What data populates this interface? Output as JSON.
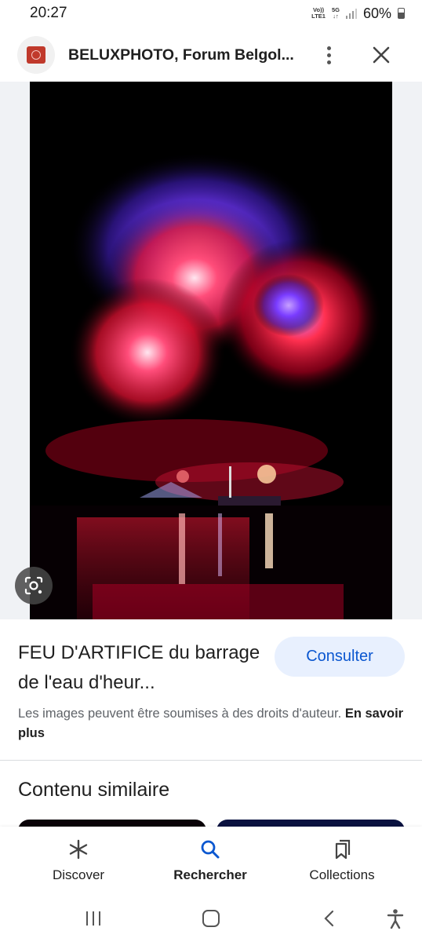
{
  "status_bar": {
    "time": "20:27",
    "network_top": "Vo))",
    "network_bottom": "LTE1",
    "net_gen": "5G",
    "net_arrows": "↓↑",
    "battery": "60%"
  },
  "header": {
    "title": "BELUXPHOTO, Forum Belgol..."
  },
  "result": {
    "title": "FEU D'ARTIFICE du barrage de l'eau d'heur...",
    "consult_label": "Consulter",
    "copyright_text": "Les images peuvent être soumises à des droits d'auteur. ",
    "learn_more": "En savoir plus"
  },
  "similar": {
    "title": "Contenu similaire"
  },
  "bottom_nav": {
    "items": [
      {
        "label": "Discover",
        "icon": "asterisk-icon"
      },
      {
        "label": "Rechercher",
        "icon": "search-icon",
        "active": true
      },
      {
        "label": "Collections",
        "icon": "bookmark-icon"
      }
    ]
  },
  "colors": {
    "accent": "#0b57d0",
    "consult_bg": "#e8f0fe"
  }
}
